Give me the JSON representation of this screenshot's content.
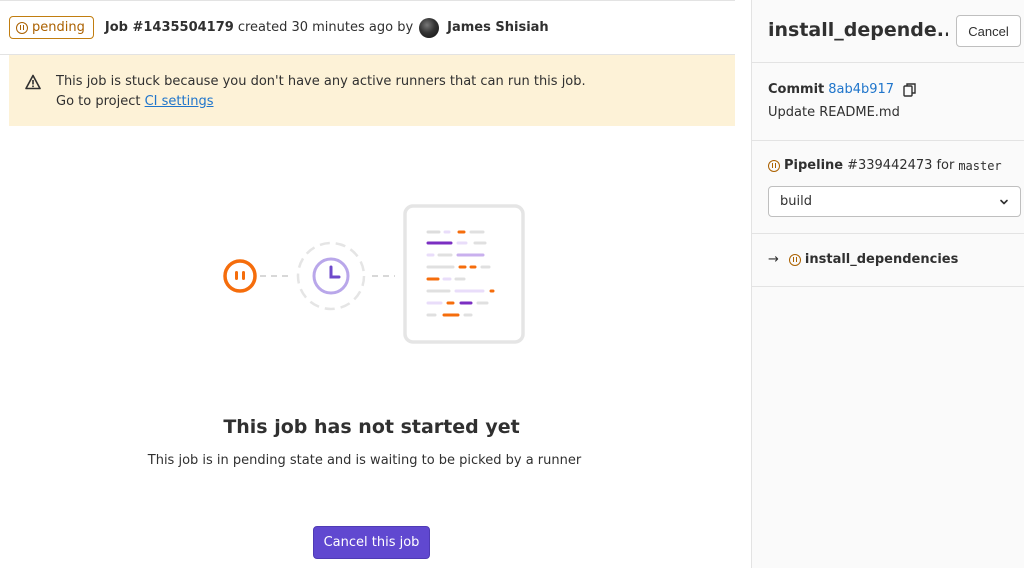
{
  "header": {
    "status": "pending",
    "job_id": "Job #1435504179",
    "created_text": "created 30 minutes ago by",
    "author": "James Shisiah"
  },
  "alert": {
    "line1": "This job is stuck because you don't have any active runners that can run this job.",
    "line2_prefix": "Go to project",
    "link_text": "CI settings"
  },
  "empty_state": {
    "title": "This job has not started yet",
    "description": "This job is in pending state and is waiting to be picked by a runner",
    "cancel_button": "Cancel this job"
  },
  "sidebar": {
    "title": "install_depende...",
    "cancel_button": "Cancel",
    "commit_label": "Commit",
    "commit_sha": "8ab4b917",
    "commit_message": "Update README.md",
    "pipeline_label": "Pipeline",
    "pipeline_id": "#339442473",
    "pipeline_for": "for",
    "branch": "master",
    "stage_selected": "build",
    "job_name": "install_dependencies",
    "arrow": "→"
  },
  "colors": {
    "pending": "#ab6100",
    "accent": "#6048d0",
    "alert_bg": "#fdf2d7",
    "link": "#1f75cb"
  },
  "icons": [
    "pause-circle-icon",
    "warning-icon",
    "clock-icon",
    "copy-icon",
    "chevron-down-icon"
  ]
}
